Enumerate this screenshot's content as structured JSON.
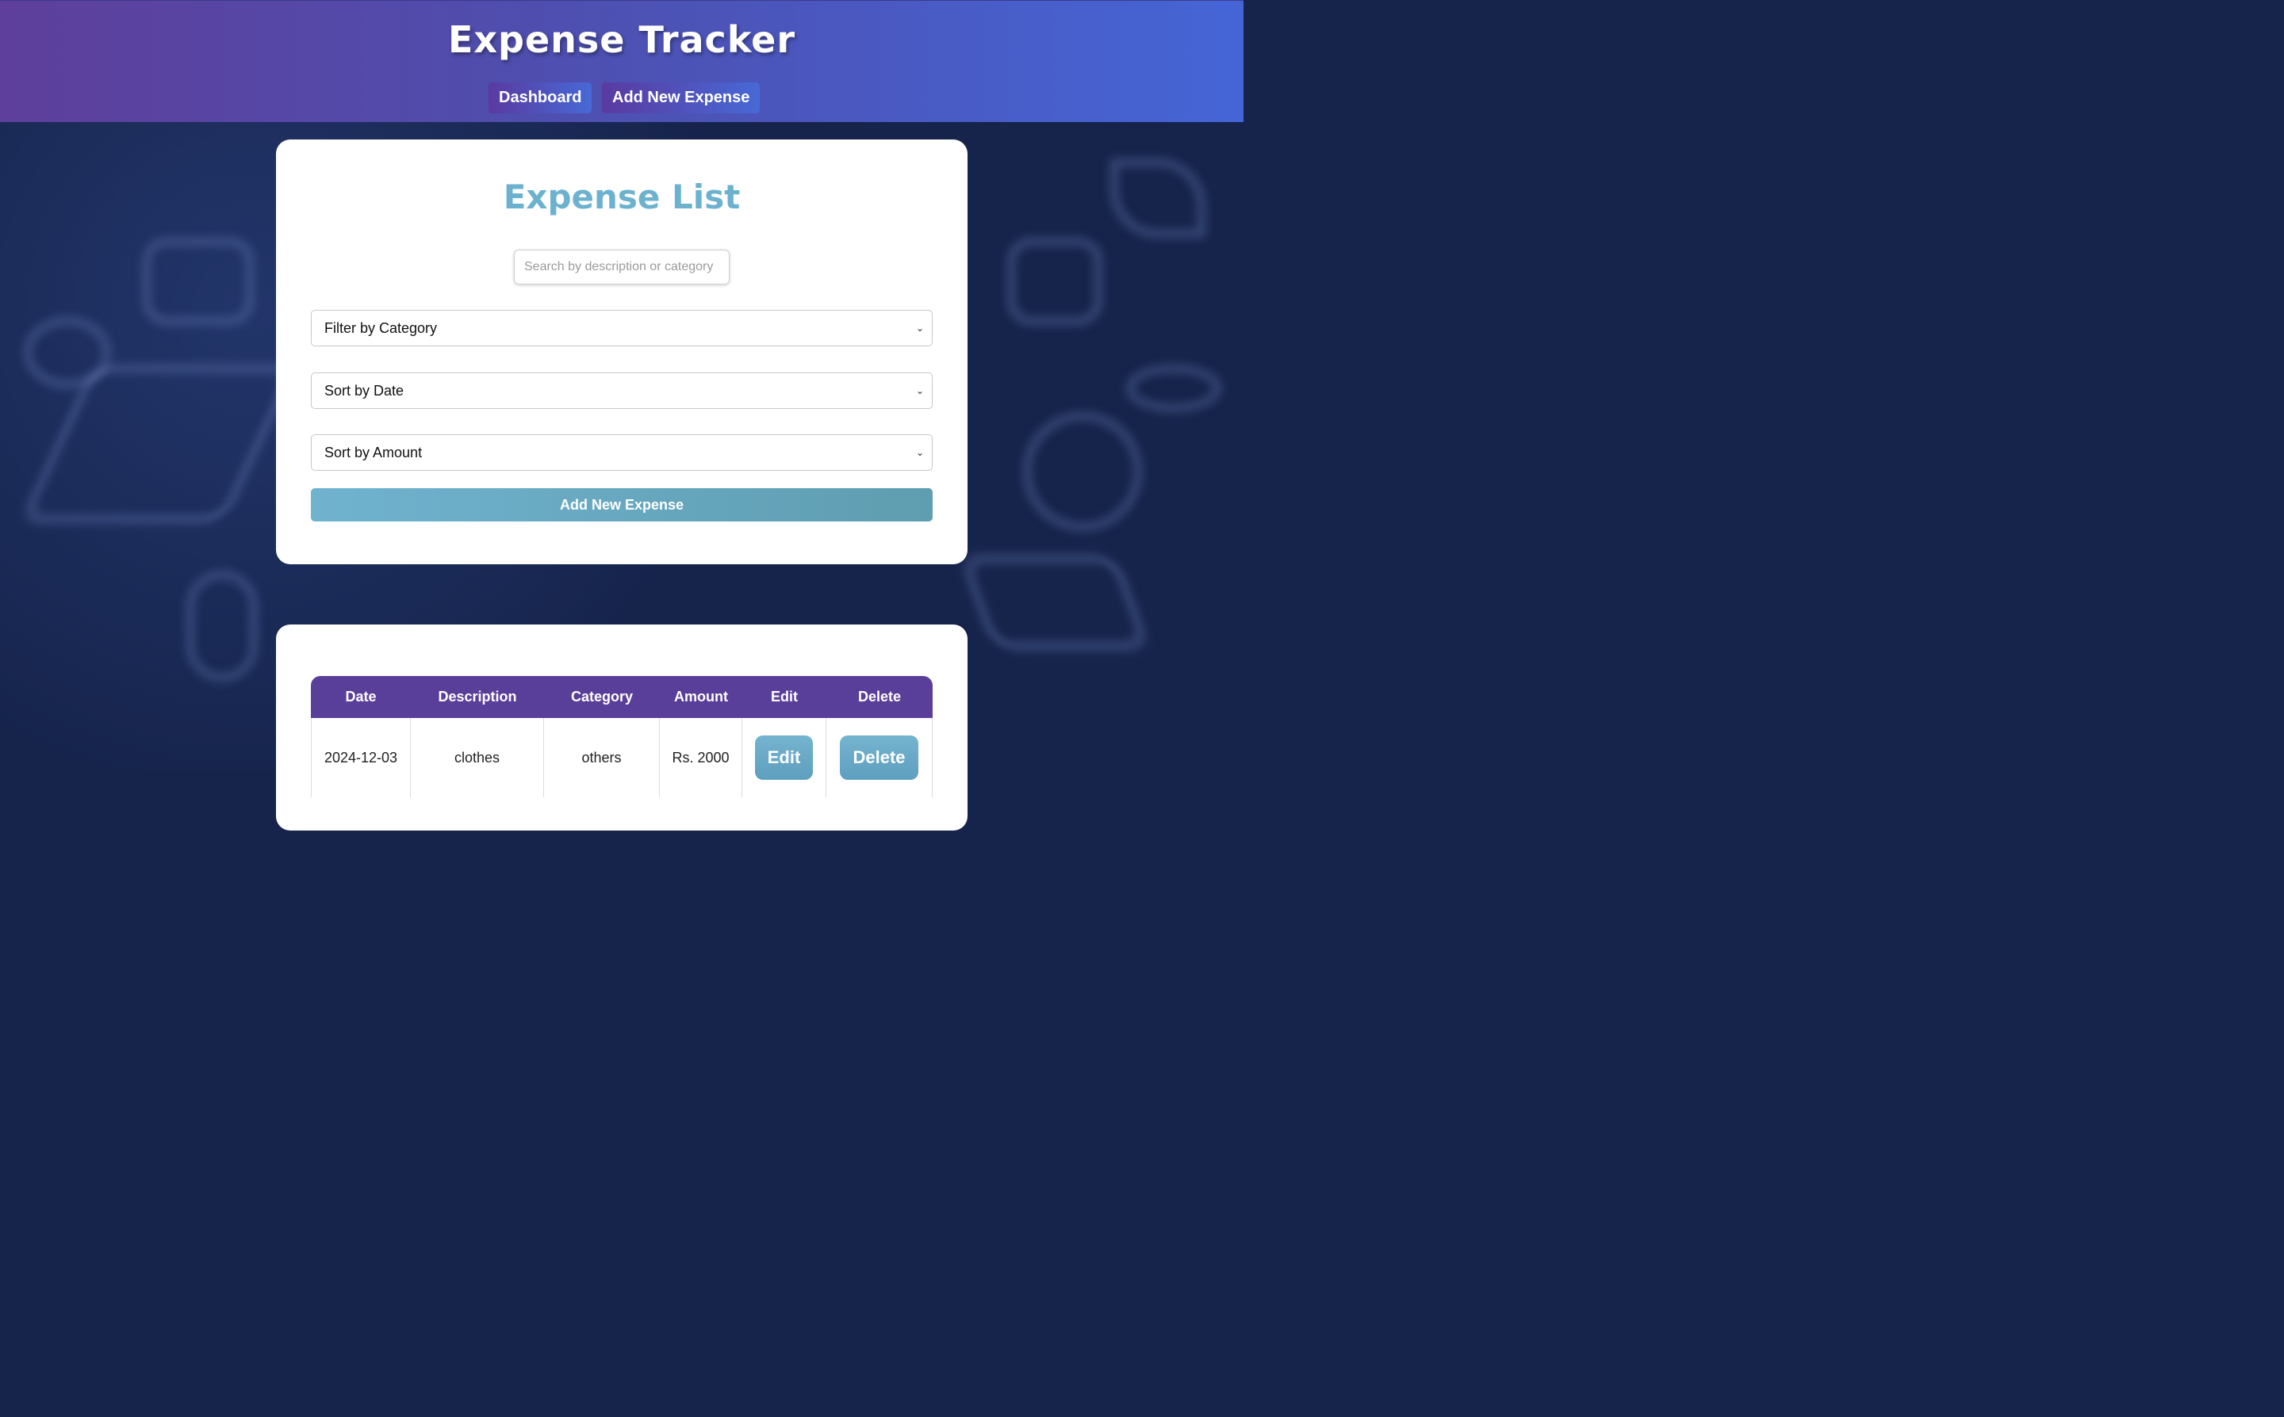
{
  "header": {
    "title": "Expense Tracker",
    "nav": [
      {
        "label": "Dashboard"
      },
      {
        "label": "Add New Expense"
      }
    ]
  },
  "controls": {
    "title": "Expense List",
    "search_placeholder": "Search by description or category",
    "filter_category": "Filter by Category",
    "sort_date": "Sort by Date",
    "sort_amount": "Sort by Amount",
    "add_button": "Add New Expense"
  },
  "table": {
    "columns": [
      "Date",
      "Description",
      "Category",
      "Amount",
      "Edit",
      "Delete"
    ],
    "rows": [
      {
        "date": "2024-12-03",
        "description": "clothes",
        "category": "others",
        "amount": "Rs. 2000",
        "edit": "Edit",
        "delete": "Delete"
      }
    ]
  },
  "colors": {
    "header_gradient_start": "#5e3f9b",
    "header_gradient_end": "#4565d6",
    "accent_teal": "#6cb2cf",
    "table_header": "#5a3f9a",
    "background": "#16244c"
  }
}
